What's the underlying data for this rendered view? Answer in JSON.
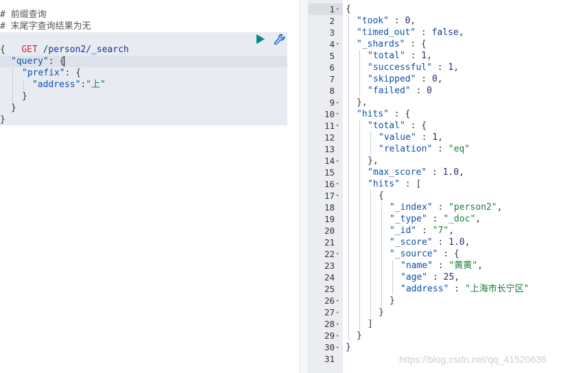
{
  "console": {
    "comment1": "# 前缀查询",
    "comment2": "# 末尾字查询结果为无",
    "method": "GET",
    "endpoint": "/person2/_search",
    "body": {
      "l1": "{",
      "l2_key": "\"query\"",
      "l2_rest": ": {",
      "l3_key": "\"prefix\"",
      "l3_rest": ": {",
      "l4_key": "\"address\"",
      "l4_colon": ":",
      "l4_val": "\"上\"",
      "l5": "}",
      "l6": "}",
      "l7": "}"
    }
  },
  "response": {
    "lines": [
      {
        "n": "1",
        "fold": "down",
        "indent": 0,
        "parts": [
          [
            "p",
            "{"
          ]
        ]
      },
      {
        "n": "2",
        "fold": "",
        "indent": 1,
        "parts": [
          [
            "k",
            "\"took\""
          ],
          [
            "p",
            " : "
          ],
          [
            "n",
            "0"
          ],
          [
            "p",
            ","
          ]
        ]
      },
      {
        "n": "3",
        "fold": "",
        "indent": 1,
        "parts": [
          [
            "k",
            "\"timed_out\""
          ],
          [
            "p",
            " : "
          ],
          [
            "u",
            "false"
          ],
          [
            "p",
            ","
          ]
        ]
      },
      {
        "n": "4",
        "fold": "down",
        "indent": 1,
        "parts": [
          [
            "k",
            "\"_shards\""
          ],
          [
            "p",
            " : {"
          ]
        ]
      },
      {
        "n": "5",
        "fold": "",
        "indent": 2,
        "parts": [
          [
            "k",
            "\"total\""
          ],
          [
            "p",
            " : "
          ],
          [
            "n",
            "1"
          ],
          [
            "p",
            ","
          ]
        ]
      },
      {
        "n": "6",
        "fold": "",
        "indent": 2,
        "parts": [
          [
            "k",
            "\"successful\""
          ],
          [
            "p",
            " : "
          ],
          [
            "n",
            "1"
          ],
          [
            "p",
            ","
          ]
        ]
      },
      {
        "n": "7",
        "fold": "",
        "indent": 2,
        "parts": [
          [
            "k",
            "\"skipped\""
          ],
          [
            "p",
            " : "
          ],
          [
            "n",
            "0"
          ],
          [
            "p",
            ","
          ]
        ]
      },
      {
        "n": "8",
        "fold": "",
        "indent": 2,
        "parts": [
          [
            "k",
            "\"failed\""
          ],
          [
            "p",
            " : "
          ],
          [
            "n",
            "0"
          ]
        ]
      },
      {
        "n": "9",
        "fold": "up",
        "indent": 1,
        "parts": [
          [
            "p",
            "},"
          ]
        ]
      },
      {
        "n": "10",
        "fold": "down",
        "indent": 1,
        "parts": [
          [
            "k",
            "\"hits\""
          ],
          [
            "p",
            " : {"
          ]
        ]
      },
      {
        "n": "11",
        "fold": "down",
        "indent": 2,
        "parts": [
          [
            "k",
            "\"total\""
          ],
          [
            "p",
            " : {"
          ]
        ]
      },
      {
        "n": "12",
        "fold": "",
        "indent": 3,
        "parts": [
          [
            "k",
            "\"value\""
          ],
          [
            "p",
            " : "
          ],
          [
            "n",
            "1"
          ],
          [
            "p",
            ","
          ]
        ]
      },
      {
        "n": "13",
        "fold": "",
        "indent": 3,
        "parts": [
          [
            "k",
            "\"relation\""
          ],
          [
            "p",
            " : "
          ],
          [
            "s",
            "\"eq\""
          ]
        ]
      },
      {
        "n": "14",
        "fold": "up",
        "indent": 2,
        "parts": [
          [
            "p",
            "},"
          ]
        ]
      },
      {
        "n": "15",
        "fold": "",
        "indent": 2,
        "parts": [
          [
            "k",
            "\"max_score\""
          ],
          [
            "p",
            " : "
          ],
          [
            "n",
            "1.0"
          ],
          [
            "p",
            ","
          ]
        ]
      },
      {
        "n": "16",
        "fold": "down",
        "indent": 2,
        "parts": [
          [
            "k",
            "\"hits\""
          ],
          [
            "p",
            " : ["
          ]
        ]
      },
      {
        "n": "17",
        "fold": "down",
        "indent": 3,
        "parts": [
          [
            "p",
            "{"
          ]
        ]
      },
      {
        "n": "18",
        "fold": "",
        "indent": 4,
        "parts": [
          [
            "k",
            "\"_index\""
          ],
          [
            "p",
            " : "
          ],
          [
            "s",
            "\"person2\""
          ],
          [
            "p",
            ","
          ]
        ]
      },
      {
        "n": "19",
        "fold": "",
        "indent": 4,
        "parts": [
          [
            "k",
            "\"_type\""
          ],
          [
            "p",
            " : "
          ],
          [
            "s",
            "\"_doc\""
          ],
          [
            "p",
            ","
          ]
        ]
      },
      {
        "n": "20",
        "fold": "",
        "indent": 4,
        "parts": [
          [
            "k",
            "\"_id\""
          ],
          [
            "p",
            " : "
          ],
          [
            "s",
            "\"7\""
          ],
          [
            "p",
            ","
          ]
        ]
      },
      {
        "n": "21",
        "fold": "",
        "indent": 4,
        "parts": [
          [
            "k",
            "\"_score\""
          ],
          [
            "p",
            " : "
          ],
          [
            "n",
            "1.0"
          ],
          [
            "p",
            ","
          ]
        ]
      },
      {
        "n": "22",
        "fold": "down",
        "indent": 4,
        "parts": [
          [
            "k",
            "\"_source\""
          ],
          [
            "p",
            " : {"
          ]
        ]
      },
      {
        "n": "23",
        "fold": "",
        "indent": 5,
        "parts": [
          [
            "k",
            "\"name\""
          ],
          [
            "p",
            " : "
          ],
          [
            "s",
            "\"黄黄\""
          ],
          [
            "p",
            ","
          ]
        ]
      },
      {
        "n": "24",
        "fold": "",
        "indent": 5,
        "parts": [
          [
            "k",
            "\"age\""
          ],
          [
            "p",
            " : "
          ],
          [
            "n",
            "25"
          ],
          [
            "p",
            ","
          ]
        ]
      },
      {
        "n": "25",
        "fold": "",
        "indent": 5,
        "parts": [
          [
            "k",
            "\"address\""
          ],
          [
            "p",
            " : "
          ],
          [
            "s",
            "\"上海市长宁区\""
          ]
        ]
      },
      {
        "n": "26",
        "fold": "up",
        "indent": 4,
        "parts": [
          [
            "p",
            "}"
          ]
        ]
      },
      {
        "n": "27",
        "fold": "up",
        "indent": 3,
        "parts": [
          [
            "p",
            "}"
          ]
        ]
      },
      {
        "n": "28",
        "fold": "up",
        "indent": 2,
        "parts": [
          [
            "p",
            "]"
          ]
        ]
      },
      {
        "n": "29",
        "fold": "up",
        "indent": 1,
        "parts": [
          [
            "p",
            "}"
          ]
        ]
      },
      {
        "n": "30",
        "fold": "up",
        "indent": 0,
        "parts": [
          [
            "p",
            "}"
          ]
        ]
      },
      {
        "n": "31",
        "fold": "",
        "indent": 0,
        "parts": []
      }
    ]
  },
  "watermark": "https://blog.csdn.net/qq_41520636",
  "icons": {
    "run": "play-icon",
    "settings": "wrench-icon"
  },
  "colors": {
    "run_button": "#00897b",
    "method": "#c7254e",
    "key": "#0b4fa8",
    "string": "#1a7b3b"
  }
}
